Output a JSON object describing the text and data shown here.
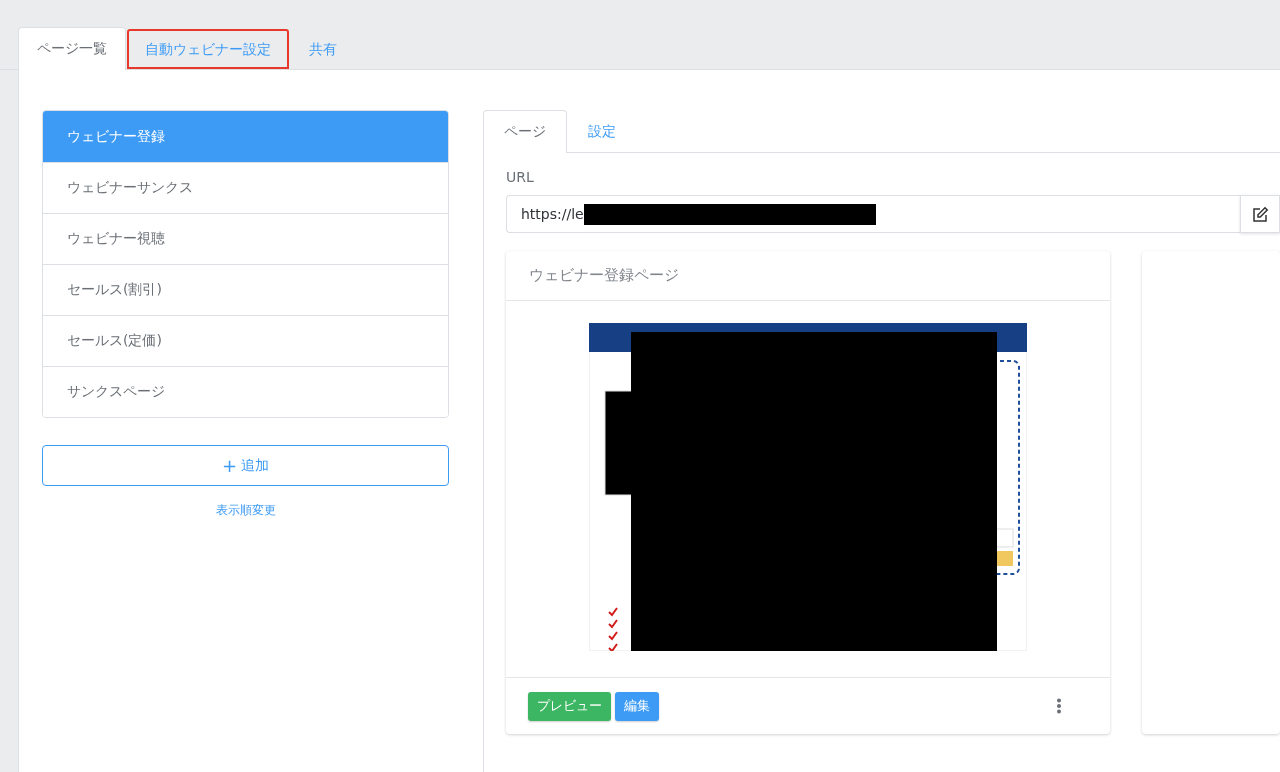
{
  "top_tabs": [
    {
      "label": "ページ一覧",
      "selected": true,
      "highlighted": false
    },
    {
      "label": "自動ウェビナー設定",
      "selected": false,
      "highlighted": true
    },
    {
      "label": "共有",
      "selected": false,
      "highlighted": false
    }
  ],
  "pages": [
    {
      "label": "ウェビナー登録",
      "selected": true
    },
    {
      "label": "ウェビナーサンクス",
      "selected": false
    },
    {
      "label": "ウェビナー視聴",
      "selected": false
    },
    {
      "label": "セールス(割引)",
      "selected": false
    },
    {
      "label": "セールス(定価)",
      "selected": false
    },
    {
      "label": "サンクスページ",
      "selected": false
    }
  ],
  "add_button": {
    "icon": "+",
    "label": "追加"
  },
  "reorder_link": "表示順変更",
  "detail_tabs": [
    {
      "label": "ページ",
      "selected": true
    },
    {
      "label": "設定",
      "selected": false
    }
  ],
  "url": {
    "label": "URL",
    "value": "https://le",
    "redacted": true
  },
  "card": {
    "title": "ウェビナー登録ページ",
    "buttons": [
      {
        "label": "プレビュー",
        "kind": "success"
      },
      {
        "label": "編集",
        "kind": "primary"
      }
    ]
  }
}
